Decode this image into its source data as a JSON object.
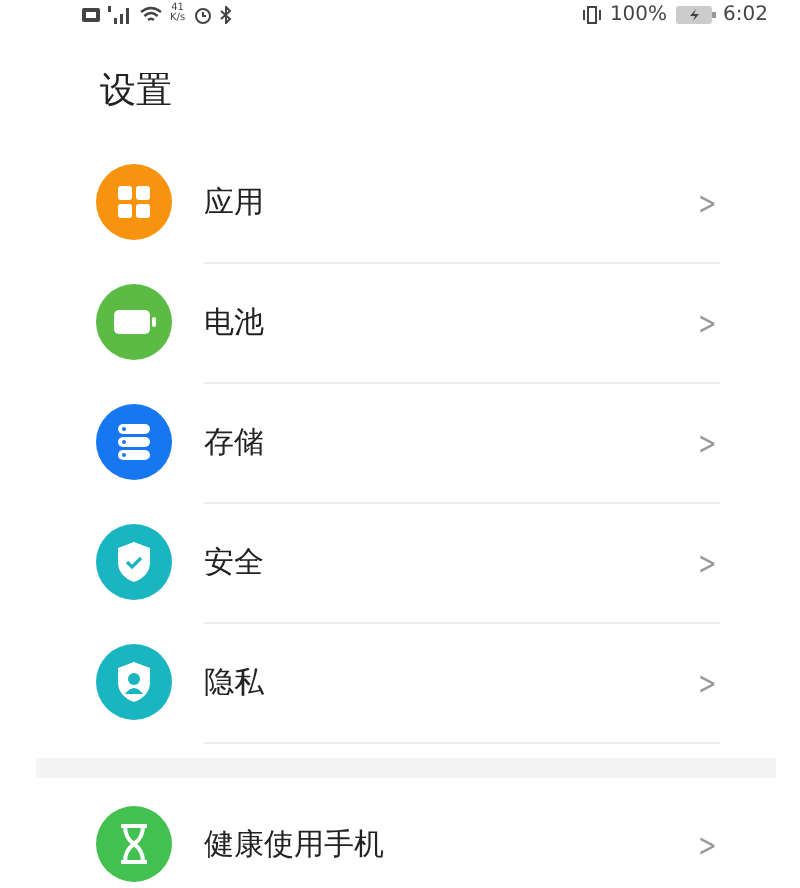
{
  "status_bar": {
    "speed_value": "41",
    "speed_unit": "K/s",
    "battery_percent": "100%",
    "time": "6:02"
  },
  "title": "设置",
  "sections": [
    {
      "items": [
        {
          "label": "应用",
          "kind": "apps",
          "color": "#f7930f",
          "chevron": ">"
        },
        {
          "label": "电池",
          "kind": "battery",
          "color": "#5cbb45",
          "chevron": ">"
        },
        {
          "label": "存储",
          "kind": "storage",
          "color": "#1677f0",
          "chevron": ">"
        },
        {
          "label": "安全",
          "kind": "security",
          "color": "#19b5c0",
          "chevron": ">"
        },
        {
          "label": "隐私",
          "kind": "privacy",
          "color": "#19b5c0",
          "chevron": ">"
        }
      ]
    },
    {
      "items": [
        {
          "label": "健康使用手机",
          "kind": "hourglass",
          "color": "#42c050",
          "chevron": ">"
        }
      ]
    }
  ]
}
